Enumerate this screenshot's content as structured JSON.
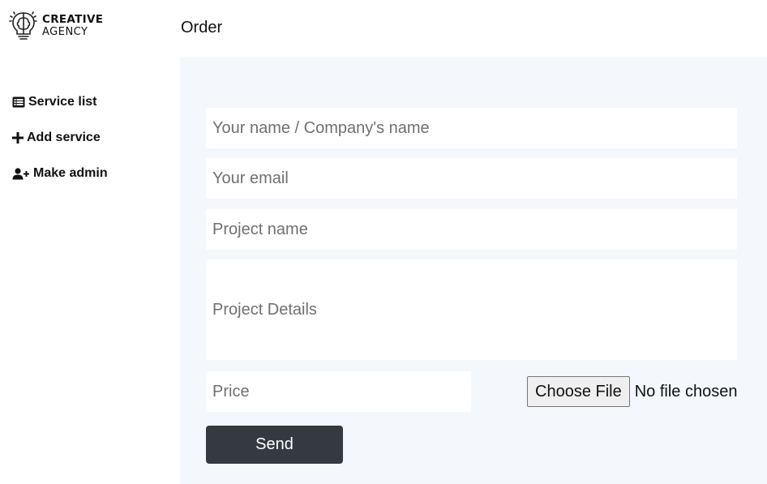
{
  "brand": {
    "line1": "CREATIVE",
    "line2": "AGENCY",
    "icon": "brain-bulb-icon"
  },
  "sidebar": {
    "items": [
      {
        "label": "Service list",
        "icon": "list-icon"
      },
      {
        "label": "Add service",
        "icon": "plus-icon"
      },
      {
        "label": "Make admin",
        "icon": "user-plus-icon"
      }
    ]
  },
  "header": {
    "title": "Order"
  },
  "form": {
    "name_placeholder": "Your name / Company's name",
    "email_placeholder": "Your email",
    "project_placeholder": "Project name",
    "details_placeholder": "Project Details",
    "price_placeholder": "Price",
    "file_button_label": "Choose File",
    "file_status": "No file chosen",
    "submit_label": "Send"
  },
  "colors": {
    "main_background": "#f4f7fc",
    "button_background": "#353a40",
    "button_text": "#ffffff"
  }
}
